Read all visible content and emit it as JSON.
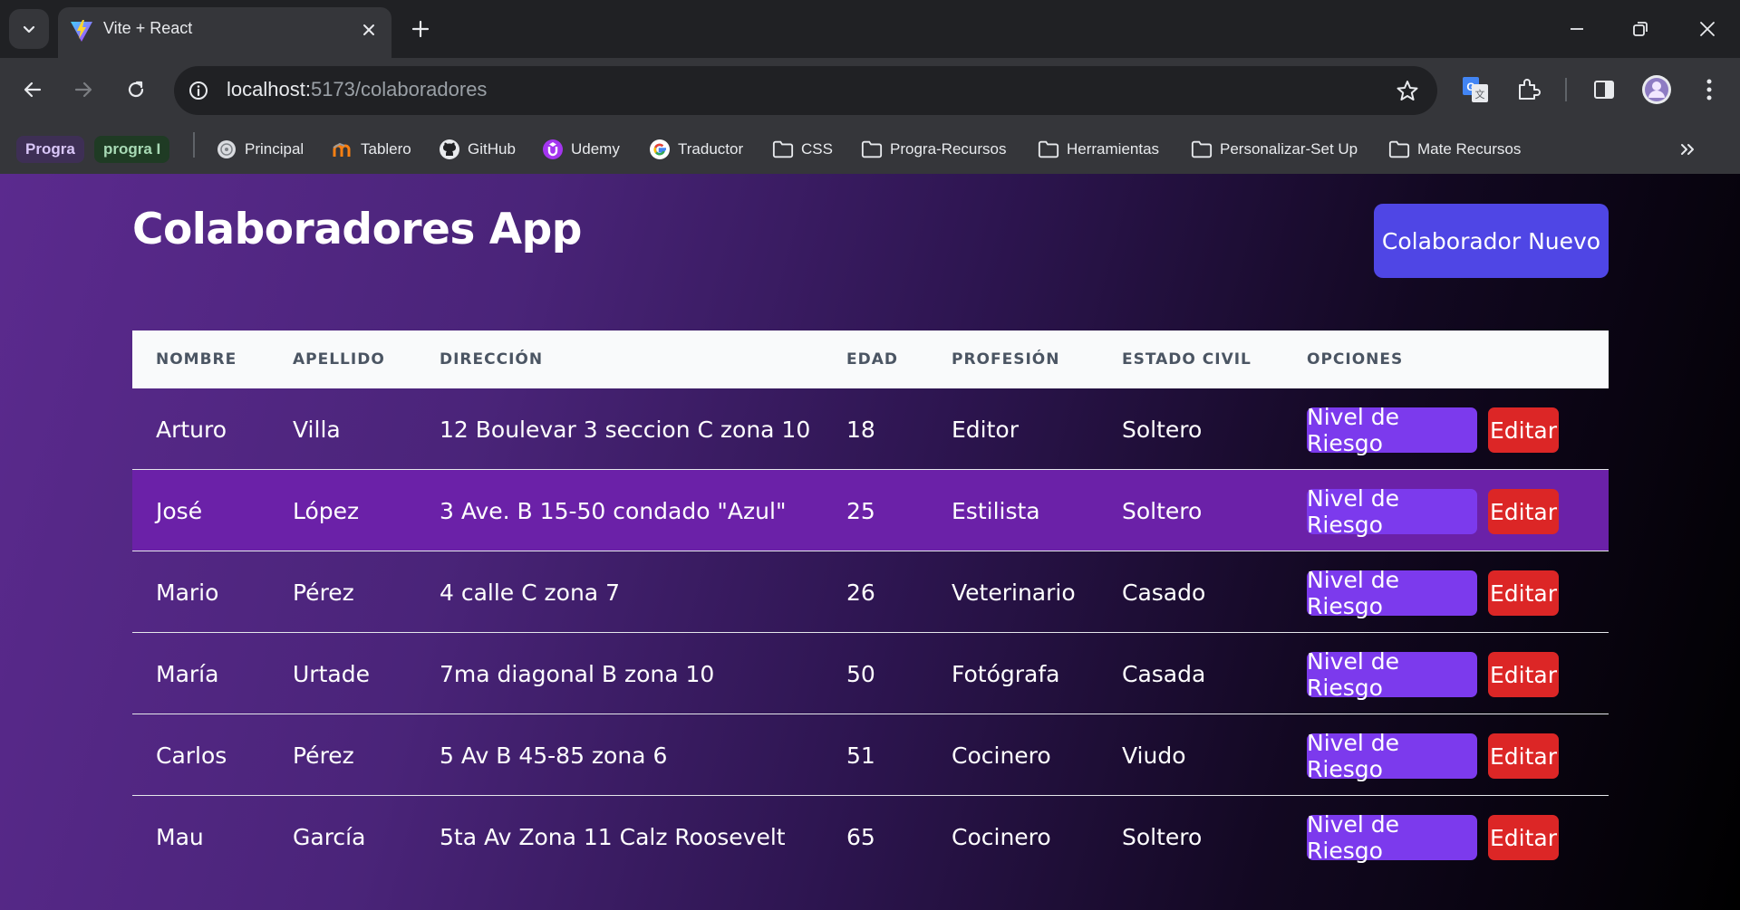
{
  "browser": {
    "tab_title": "Vite + React",
    "url_host": "localhost:",
    "url_path": "5173/colaboradores",
    "tab_groups": [
      {
        "label": "Progra",
        "bg": "#3e2f55",
        "color": "#d9c6f8"
      },
      {
        "label": "progra I",
        "bg": "#1f3b24",
        "color": "#a8dab5"
      }
    ],
    "bookmarks": [
      {
        "label": "Principal",
        "icon": "globe-icon"
      },
      {
        "label": "Tablero",
        "icon": "moodle-icon"
      },
      {
        "label": "GitHub",
        "icon": "github-icon"
      },
      {
        "label": "Udemy",
        "icon": "udemy-icon"
      },
      {
        "label": "Traductor",
        "icon": "google-icon"
      },
      {
        "label": "CSS",
        "icon": "folder-icon"
      },
      {
        "label": "Progra-Recursos",
        "icon": "folder-icon"
      },
      {
        "label": "Herramientas",
        "icon": "folder-icon"
      },
      {
        "label": "Personalizar-Set Up",
        "icon": "folder-icon"
      },
      {
        "label": "Mate Recursos",
        "icon": "folder-icon"
      }
    ]
  },
  "app": {
    "title": "Colaboradores App",
    "new_button": "Colaborador Nuevo",
    "columns": [
      "NOMBRE",
      "APELLIDO",
      "DIRECCIÓN",
      "EDAD",
      "PROFESIÓN",
      "ESTADO CIVIL",
      "OPCIONES"
    ],
    "rows": [
      {
        "nombre": "Arturo",
        "apellido": "Villa",
        "direccion": "12 Boulevar 3 seccion C zona 10",
        "edad": "18",
        "profesion": "Editor",
        "estado": "Soltero"
      },
      {
        "nombre": "José",
        "apellido": "López",
        "direccion": "3 Ave. B 15-50 condado \"Azul\"",
        "edad": "25",
        "profesion": "Estilista",
        "estado": "Soltero"
      },
      {
        "nombre": "Mario",
        "apellido": "Pérez",
        "direccion": "4 calle C zona 7",
        "edad": "26",
        "profesion": "Veterinario",
        "estado": "Casado"
      },
      {
        "nombre": "María",
        "apellido": "Urtade",
        "direccion": "7ma diagonal B zona 10",
        "edad": "50",
        "profesion": "Fotógrafa",
        "estado": "Casada"
      },
      {
        "nombre": "Carlos",
        "apellido": "Pérez",
        "direccion": "5 Av B 45-85 zona 6",
        "edad": "51",
        "profesion": "Cocinero",
        "estado": "Viudo"
      },
      {
        "nombre": "Mau",
        "apellido": "García",
        "direccion": "5ta Av Zona 11 Calz Roosevelt",
        "edad": "65",
        "profesion": "Cocinero",
        "estado": "Soltero"
      }
    ],
    "riesgo_label": "Nivel de Riesgo",
    "editar_label": "Editar",
    "colors": {
      "accent": "#4f46e5",
      "riesgo": "#7c3aed",
      "editar": "#dc2626",
      "highlight_row": "#6b21a8"
    }
  }
}
